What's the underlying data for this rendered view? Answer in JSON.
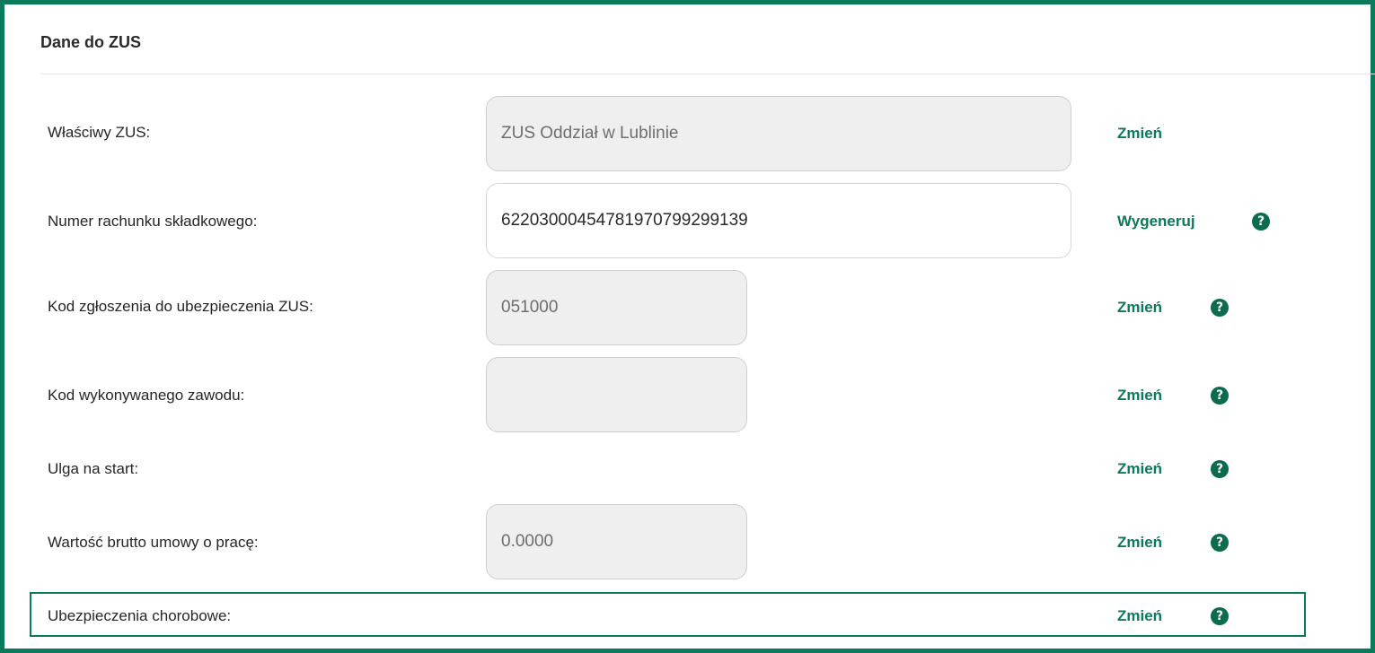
{
  "section": {
    "title": "Dane do ZUS"
  },
  "rows": [
    {
      "label": "Właściwy ZUS:",
      "value": "ZUS Oddział w Lublinie",
      "action": "Zmień",
      "help": ""
    },
    {
      "label": "Numer rachunku składkowego:",
      "value": "62203000454781970799299139",
      "action": "Wygeneruj",
      "help": "?"
    },
    {
      "label": "Kod zgłoszenia do ubezpieczenia ZUS:",
      "value": "051000",
      "action": "Zmień",
      "help": "?"
    },
    {
      "label": "Kod wykonywanego zawodu:",
      "value": "",
      "action": "Zmień",
      "help": "?"
    },
    {
      "label": "Ulga na start:",
      "action": "Zmień",
      "help": "?"
    },
    {
      "label": "Wartość brutto umowy o pracę:",
      "value": "0.0000",
      "action": "Zmień",
      "help": "?"
    },
    {
      "label": "Ubezpieczenia chorobowe:",
      "action": "Zmień",
      "help": "?"
    }
  ],
  "colors": {
    "accent": "#0b7a5c",
    "help_icon": "#0b6b4e",
    "readonly_bg": "#efefef"
  },
  "icons": {
    "help": "question-circle-icon"
  }
}
